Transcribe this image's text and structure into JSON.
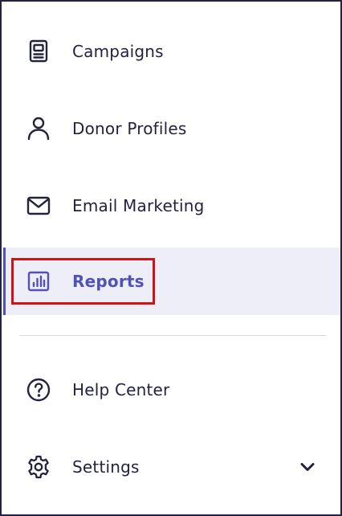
{
  "nav": {
    "items": [
      {
        "label": "Campaigns",
        "icon": "campaigns-icon"
      },
      {
        "label": "Donor Profiles",
        "icon": "person-icon"
      },
      {
        "label": "Email Marketing",
        "icon": "envelope-icon"
      },
      {
        "label": "Reports",
        "icon": "bar-chart-icon",
        "active": true
      }
    ],
    "secondary": [
      {
        "label": "Help Center",
        "icon": "question-circle-icon"
      },
      {
        "label": "Settings",
        "icon": "gear-icon",
        "expandable": true
      }
    ]
  },
  "colors": {
    "text": "#23233f",
    "active_text": "#5252b6",
    "active_bg": "#eeeef8",
    "highlight": "#d01414",
    "border": "#23233f"
  }
}
